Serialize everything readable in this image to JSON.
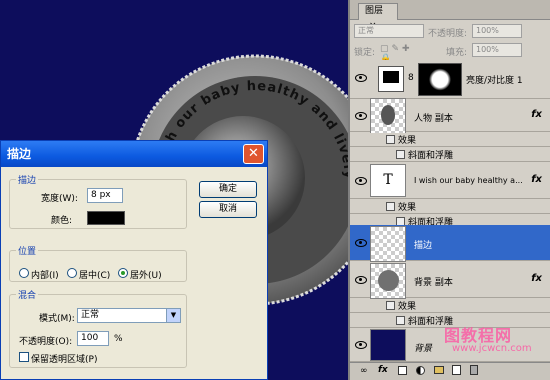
{
  "colors": {
    "canvas_bg": "#0d0d5c",
    "title_bar": "#0c5ae0",
    "selected_layer": "#3168c9",
    "accent_label": "#1540b0"
  },
  "canvas": {
    "coin_text": "I wish our baby healthy and lively smart growth"
  },
  "dialog": {
    "title": "描边",
    "close_icon": "✕",
    "stroke_group": "描边",
    "width_label": "宽度(W):",
    "width_value": "8 px",
    "color_label": "颜色:",
    "position_group": "位置",
    "pos_inside": "内部(I)",
    "pos_center": "居中(C)",
    "pos_outside": "居外(U)",
    "blend_group": "混合",
    "mode_label": "模式(M):",
    "mode_value": "正常",
    "opacity_label": "不透明度(O):",
    "opacity_value": "100",
    "opacity_unit": "%",
    "preserve_label": "保留透明区域(P)",
    "ok_label": "确定",
    "cancel_label": "取消"
  },
  "layers_panel": {
    "tab_label": "图层",
    "tab_close": "×",
    "blend_mode": "正常",
    "opacity_label": "不透明度:",
    "opacity_value": "100%",
    "lock_label": "锁定:",
    "fill_label": "填充:",
    "fill_value": "100%",
    "layers": [
      {
        "name": "亮度/对比度 1"
      },
      {
        "name": "人物 副本",
        "fx": "fx",
        "effects_label": "效果",
        "effect": "斜面和浮雕"
      },
      {
        "name": "I wish our baby healthy a...",
        "thumb_text": "T",
        "fx": "fx",
        "effects_label": "效果",
        "effect": "斜面和浮雕"
      },
      {
        "name": "描边"
      },
      {
        "name": "背景 副本",
        "fx": "fx",
        "effects_label": "效果",
        "effect": "斜面和浮雕"
      },
      {
        "name": "背景"
      }
    ],
    "watermark": "图教程网",
    "watermark_url": "www.jcwcn.com"
  }
}
